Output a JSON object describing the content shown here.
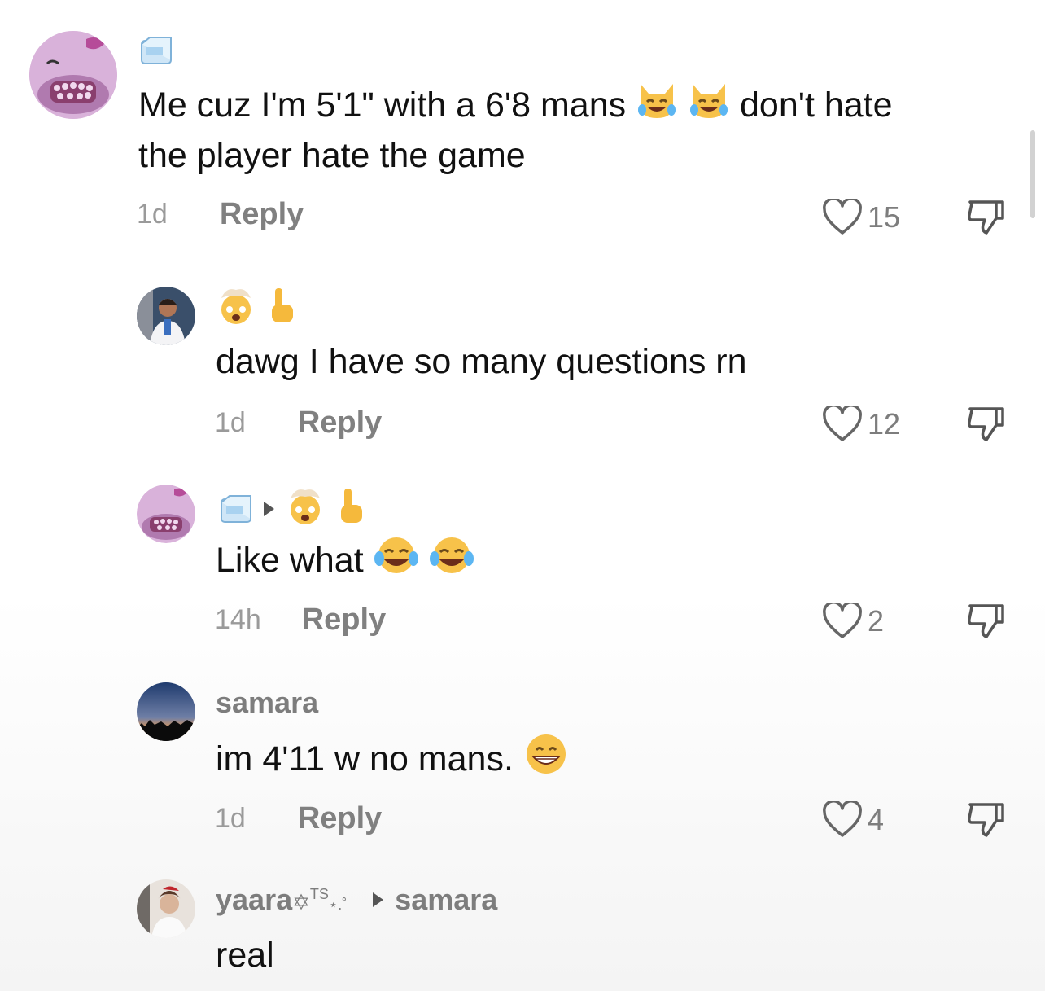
{
  "comments": [
    {
      "text_line1": "Me cuz I'm 5'1\" with a 6'8 mans",
      "text_after_emoji": "don't hate",
      "text_line2": "the player hate the game",
      "time": "1d",
      "reply": "Reply",
      "likes": "15",
      "icons": {
        "name": "ice-cube-icon",
        "emoji": "cat-with-tears-of-joy"
      }
    },
    {
      "text": "dawg I have so many questions rn",
      "time": "1d",
      "reply": "Reply",
      "likes": "12",
      "icons": {
        "name": "exploding-head-emoji + pointing-up-emoji"
      }
    },
    {
      "text": "Like what",
      "time": "14h",
      "reply": "Reply",
      "likes": "2",
      "icons": {
        "name": "ice-cube-icon ▸ exploding-head pointing-up",
        "emoji": "face-with-tears-of-joy"
      }
    },
    {
      "username": "samara",
      "text": "im 4'11 w no mans.",
      "time": "1d",
      "reply": "Reply",
      "likes": "4",
      "icons": {
        "emoji": "grinning-face"
      }
    },
    {
      "username": "yaara",
      "username_decor": "TS",
      "reply_to": "samara",
      "text": "real"
    }
  ],
  "colors": {
    "meta_gray": "#7d7d7d",
    "text": "#111111",
    "avatar_pink": "#c9a0c9"
  }
}
